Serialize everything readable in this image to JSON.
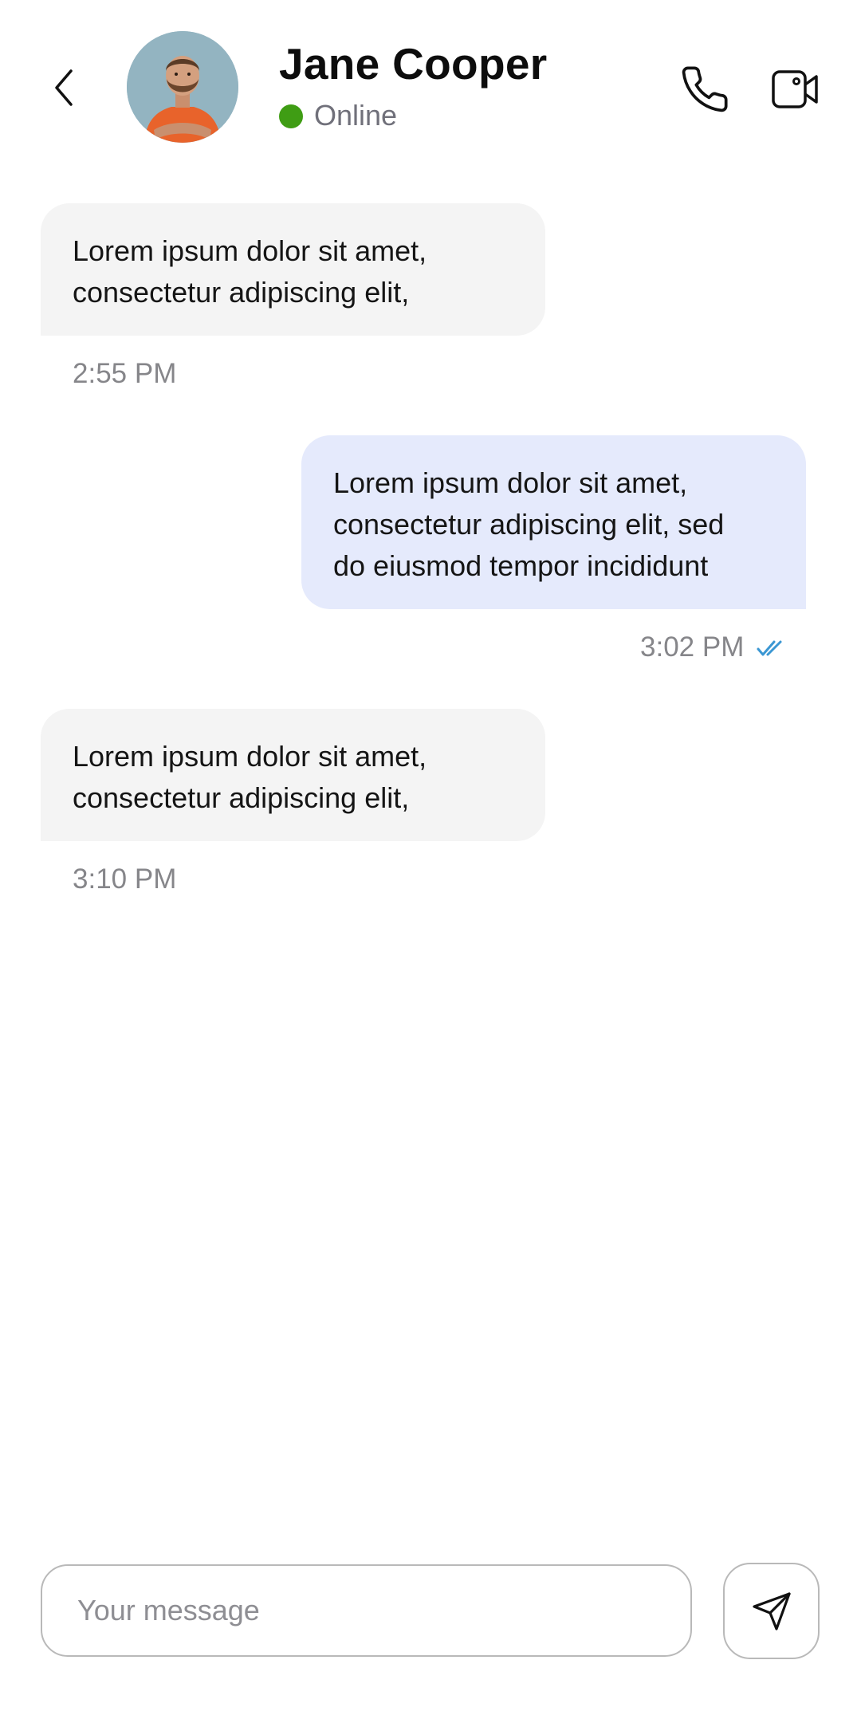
{
  "header": {
    "contact_name": "Jane Cooper",
    "status": "Online",
    "status_color": "#3f9d14",
    "back_icon": "chevron-left-icon",
    "call_icon": "phone-icon",
    "video_icon": "video-camera-icon"
  },
  "messages": [
    {
      "direction": "incoming",
      "lines": [
        "Lorem ipsum dolor sit amet,",
        "consectetur adipiscing elit,"
      ],
      "time": "2:55 PM"
    },
    {
      "direction": "outgoing",
      "lines": [
        "Lorem ipsum dolor sit amet,",
        "consectetur adipiscing elit, sed",
        "do eiusmod tempor incididunt"
      ],
      "time": "3:02 PM",
      "read_receipt_icon": "double-check-icon",
      "read_receipt_color": "#3b97d3"
    },
    {
      "direction": "incoming",
      "lines": [
        "Lorem ipsum dolor sit amet,",
        "consectetur adipiscing elit,"
      ],
      "time": "3:10 PM"
    }
  ],
  "composer": {
    "placeholder": "Your message",
    "value": "",
    "send_icon": "send-icon"
  },
  "colors": {
    "incoming_bubble": "#f4f4f4",
    "outgoing_bubble": "#e5eafc"
  }
}
